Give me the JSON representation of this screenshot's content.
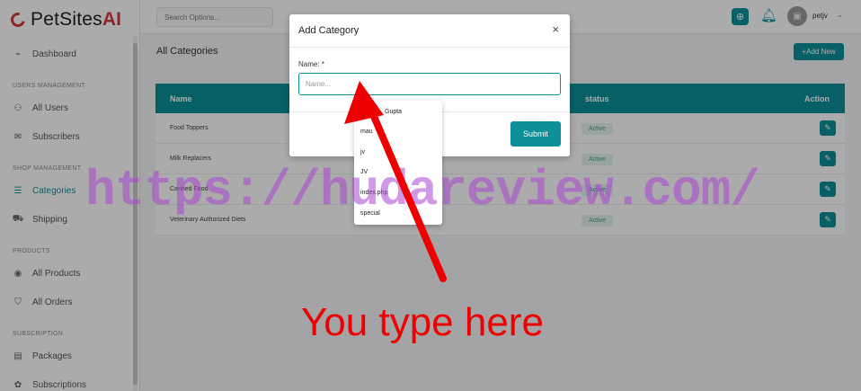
{
  "app": {
    "logo_text": "PetSites",
    "logo_accent": "AI",
    "accent_color": "#0d8f9a",
    "brand_red": "#d23a3a"
  },
  "sidebar": {
    "items_top": [
      {
        "label": "Dashboard",
        "icon": "chart-line-icon"
      }
    ],
    "sections": [
      {
        "title": "USERS MANAGEMENT",
        "items": [
          {
            "label": "All Users",
            "icon": "user-icon"
          },
          {
            "label": "Subscribers",
            "icon": "mail-icon"
          }
        ]
      },
      {
        "title": "SHOP MANAGEMENT",
        "items": [
          {
            "label": "Categories",
            "icon": "list-icon",
            "active": true
          },
          {
            "label": "Shipping",
            "icon": "truck-icon"
          }
        ]
      },
      {
        "title": "PRODUCTS",
        "items": [
          {
            "label": "All Products",
            "icon": "product-icon"
          },
          {
            "label": "All Orders",
            "icon": "cart-icon"
          }
        ]
      },
      {
        "title": "SUBSCRIPTION",
        "items": [
          {
            "label": "Packages",
            "icon": "package-icon"
          },
          {
            "label": "Subscriptions",
            "icon": "gift-icon"
          }
        ]
      }
    ]
  },
  "topbar": {
    "search_placeholder": "Search Options...",
    "username": "petjv"
  },
  "main": {
    "title": "All Categories",
    "add_new_label": "+Add New",
    "table": {
      "headers": {
        "name": "Name",
        "status": "status",
        "action": "Action"
      },
      "rows": [
        {
          "name": "Food Toppers",
          "status": "Active"
        },
        {
          "name": "Milk Replacers",
          "status": "Active"
        },
        {
          "name": "Canned Food",
          "status": "Active"
        },
        {
          "name": "Veterinary Authorized Diets",
          "status": "Active"
        }
      ]
    }
  },
  "modal": {
    "title": "Add Category",
    "close_glyph": "×",
    "field_label": "Name:",
    "required_mark": "*",
    "input_placeholder": "Name...",
    "input_value": "",
    "submit_label": "Submit"
  },
  "autocomplete": {
    "items": [
      "Gupta",
      "mau",
      "jv",
      "JV",
      "index.php",
      "special"
    ]
  },
  "annotation": {
    "watermark": "https://hudareview.com/",
    "callout": "You type here"
  }
}
